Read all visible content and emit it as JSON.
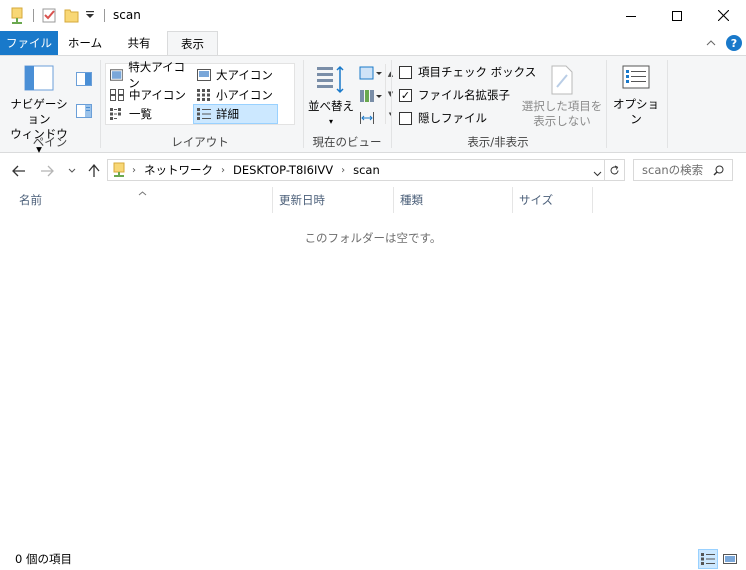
{
  "window": {
    "title": "scan"
  },
  "ribbon_tabs": [
    "ファイル",
    "ホーム",
    "共有",
    "表示"
  ],
  "ribbon": {
    "pane": {
      "nav_pane_label_1": "ナビゲーション",
      "nav_pane_label_2": "ウィンドウ",
      "group_label": "ペイン"
    },
    "layout": {
      "items": [
        "特大アイコン",
        "大アイコン",
        "中アイコン",
        "小アイコン",
        "一覧",
        "詳細"
      ],
      "selected": "詳細",
      "group_label": "レイアウト"
    },
    "current_view": {
      "sort_label": "並べ替え",
      "group_label": "現在のビュー"
    },
    "show_hide": {
      "item_checkboxes": "項目チェック ボックス",
      "item_checkboxes_checked": false,
      "file_extensions": "ファイル名拡張子",
      "file_extensions_checked": true,
      "hidden_items": "隠しファイル",
      "hidden_items_checked": false,
      "hide_selected_1": "選択した項目を",
      "hide_selected_2": "表示しない",
      "group_label": "表示/非表示"
    },
    "options_label": "オプション"
  },
  "address": {
    "crumbs": [
      "ネットワーク",
      "DESKTOP-T8I6IVV",
      "scan"
    ],
    "search_placeholder": "scanの検索"
  },
  "columns": [
    "名前",
    "更新日時",
    "種類",
    "サイズ"
  ],
  "empty_message": "このフォルダーは空です。",
  "status": {
    "item_count": "0 個の項目"
  },
  "colors": {
    "accent": "#1979ca",
    "selection": "#cce8ff",
    "folder": "#f8d775"
  }
}
